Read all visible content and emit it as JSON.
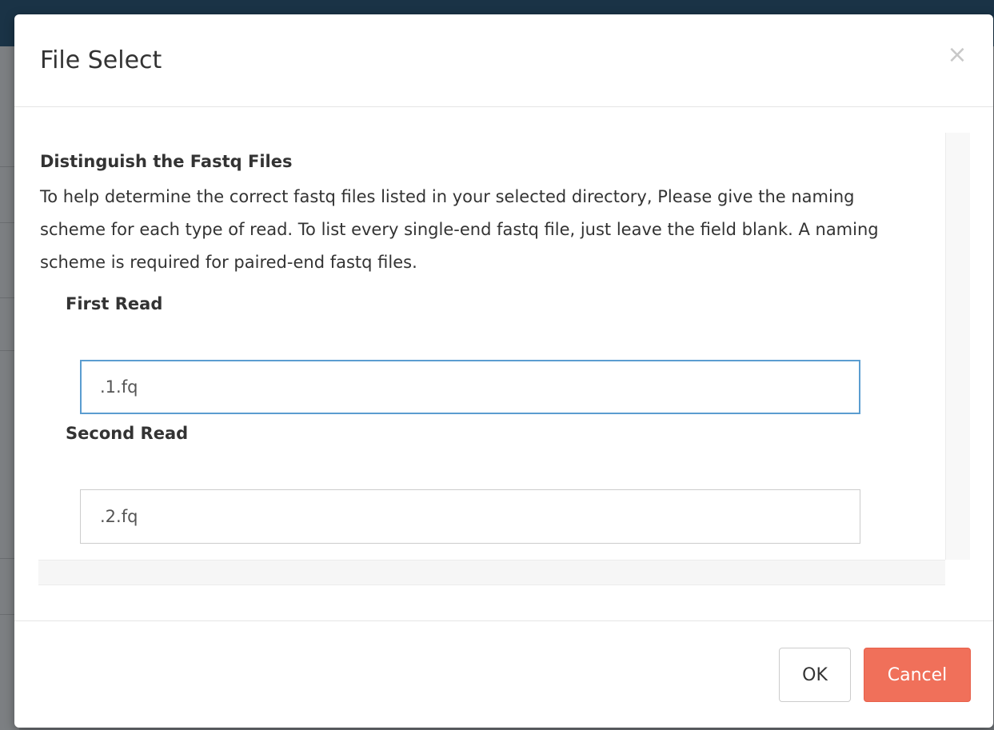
{
  "dialog": {
    "title": "File Select",
    "close_symbol": "×"
  },
  "body": {
    "section_title": "Distinguish the Fastq Files",
    "help_text": "To help determine the correct fastq files listed in your selected directory, Please give the naming scheme for each type of read. To list every single-end fastq file, just leave the field blank. A naming scheme is required for paired-end fastq files.",
    "fields": [
      {
        "label": "First Read",
        "value": ".1.fq",
        "focused": true
      },
      {
        "label": "Second Read",
        "value": ".2.fq",
        "focused": false
      }
    ]
  },
  "footer": {
    "ok_label": "OK",
    "cancel_label": "Cancel"
  },
  "colors": {
    "cancel_bg": "#f0705a",
    "focus_border": "#5b9dd0",
    "backdrop_top": "#1a3346"
  },
  "icons": {
    "close": "close-icon"
  }
}
